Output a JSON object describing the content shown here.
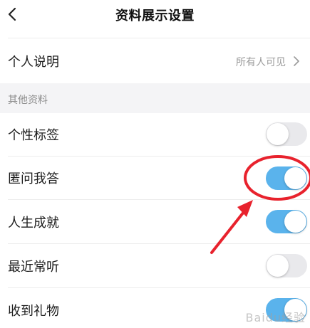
{
  "header": {
    "title": "资料展示设置",
    "back_icon": "chevron-left-icon"
  },
  "personal_note": {
    "label": "个人说明",
    "value": "所有人可见",
    "icon": "chevron-right-icon"
  },
  "section": {
    "title": "其他资料"
  },
  "toggles": [
    {
      "label": "个性标签",
      "enabled": false
    },
    {
      "label": "匿问我答",
      "enabled": true
    },
    {
      "label": "人生成就",
      "enabled": true
    },
    {
      "label": "最近常听",
      "enabled": false
    },
    {
      "label": "收到礼物",
      "enabled": true
    }
  ],
  "colors": {
    "toggle_on": "#5ab3ec",
    "toggle_off": "#e9e9ec",
    "annotation": "#e8222d"
  },
  "watermark": "Baidu经验"
}
